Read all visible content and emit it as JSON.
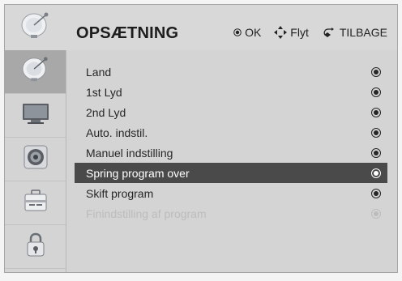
{
  "header": {
    "title": "OPSÆTNING",
    "hints": [
      {
        "icon": "ok-button-icon",
        "label": "OK"
      },
      {
        "icon": "dpad-arrows-icon",
        "label": "Flyt"
      },
      {
        "icon": "back-arrow-icon",
        "label": "TILBAGE"
      }
    ]
  },
  "sidebar": {
    "items": [
      {
        "icon": "satellite-dish-icon",
        "active": true
      },
      {
        "icon": "monitor-icon",
        "active": false
      },
      {
        "icon": "speaker-icon",
        "active": false
      },
      {
        "icon": "toolbox-icon",
        "active": false
      },
      {
        "icon": "padlock-icon",
        "active": false
      }
    ]
  },
  "menu": {
    "items": [
      {
        "label": "Land",
        "state": "normal"
      },
      {
        "label": "1st Lyd",
        "state": "normal"
      },
      {
        "label": "2nd Lyd",
        "state": "normal"
      },
      {
        "label": "Auto. indstil.",
        "state": "normal"
      },
      {
        "label": "Manuel indstilling",
        "state": "normal"
      },
      {
        "label": "Spring program over",
        "state": "selected"
      },
      {
        "label": "Skift program",
        "state": "normal"
      },
      {
        "label": "Finindstilling af program",
        "state": "disabled"
      }
    ]
  },
  "colors": {
    "selected_bg": "#4a4a4a",
    "selected_text": "#ffffff",
    "disabled_text": "#bcbcbc",
    "active_sidebar": "#a8a8a8"
  }
}
